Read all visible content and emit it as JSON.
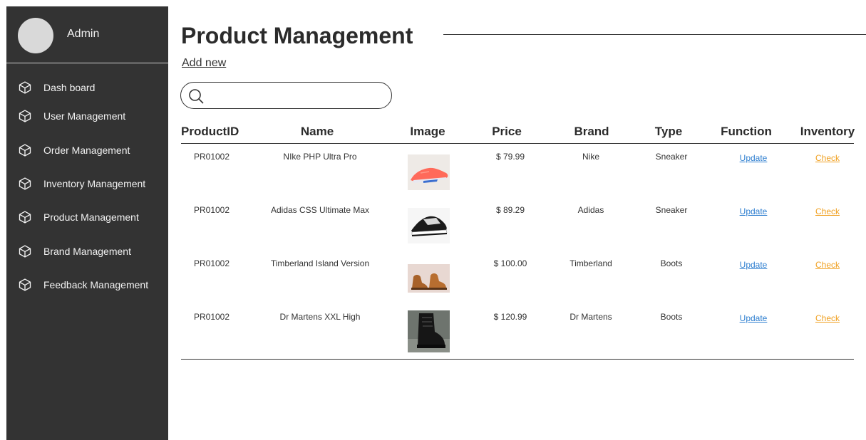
{
  "sidebar": {
    "admin_name": "Admin",
    "items": [
      {
        "label": "Dash board",
        "icon": "cube-icon"
      },
      {
        "label": "User Management",
        "icon": "cube-icon"
      },
      {
        "label": "Order Management",
        "icon": "cube-icon"
      },
      {
        "label": "Inventory Management",
        "icon": "cube-icon"
      },
      {
        "label": "Product Management",
        "icon": "cube-icon"
      },
      {
        "label": "Brand Management",
        "icon": "cube-icon"
      },
      {
        "label": "Feedback Management",
        "icon": "cube-icon"
      }
    ]
  },
  "main": {
    "title": "Product Management",
    "add_new": "Add new",
    "search": {
      "value": "",
      "placeholder": ""
    }
  },
  "table": {
    "headers": [
      "ProductID",
      "Name",
      "Image",
      "Price",
      "Brand",
      "Type",
      "Function",
      "Inventory"
    ],
    "rows": [
      {
        "id": "PR01002",
        "name": "NIke PHP Ultra Pro",
        "image": "pink-running-sneaker",
        "price": "$ 79.99",
        "brand": "Nike",
        "type": "Sneaker",
        "function": "Update",
        "inventory": "Check"
      },
      {
        "id": "PR01002",
        "name": "Adidas CSS Ultimate Max",
        "image": "black-white-sneaker",
        "price": "$ 89.29",
        "brand": "Adidas",
        "type": "Sneaker",
        "function": "Update",
        "inventory": "Check"
      },
      {
        "id": "PR01002",
        "name": "Timberland Island Version",
        "image": "tan-leather-boots",
        "price": "$ 100.00",
        "brand": "Timberland",
        "type": "Boots",
        "function": "Update",
        "inventory": "Check"
      },
      {
        "id": "PR01002",
        "name": "Dr Martens XXL High",
        "image": "black-leather-boot",
        "price": "$ 120.99",
        "brand": "Dr Martens",
        "type": "Boots",
        "function": "Update",
        "inventory": "Check"
      }
    ]
  },
  "colors": {
    "sidebar_bg": "#333333",
    "update_link": "#2f7fd0",
    "check_link": "#f0a020"
  }
}
